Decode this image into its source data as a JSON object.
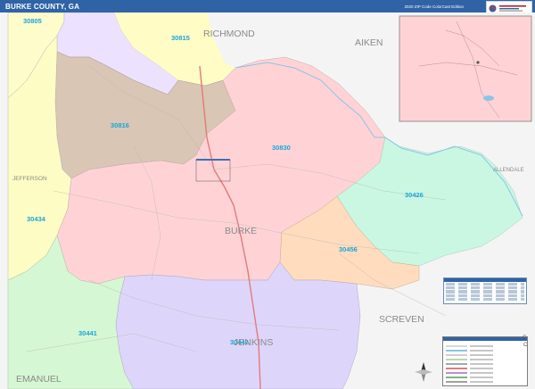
{
  "header": {
    "title": "BURKE COUNTY, GA",
    "subtitle": "2020 ZIP Code ColorCast Edition"
  },
  "map": {
    "zip_codes": [
      "30805",
      "30815",
      "30816",
      "30830",
      "30426",
      "30434",
      "30456",
      "30441",
      "30442"
    ],
    "counties": [
      "RICHMOND",
      "AIKEN",
      "ALLENDALE",
      "JEFFERSON",
      "BURKE",
      "SCREVEN",
      "JENKINS",
      "EMANUEL"
    ],
    "colors": {
      "zip_30805": "#fffccc",
      "zip_30815": "#ece2ff",
      "zip_30816": "#d9c6b4",
      "zip_30830": "#ffd3d6",
      "zip_30426": "#c9f7e2",
      "zip_30434": "#fdfcc4",
      "zip_30456": "#ffdcbd",
      "zip_30441": "#d6f7d3",
      "zip_30442": "#ded6fa",
      "outside": "#f4f4f4",
      "header": "#2f63a6",
      "zip_label": "#1aa6d9"
    }
  },
  "icons": [
    "mapping-logo-icon",
    "compass-icon",
    "city-legend-icon"
  ]
}
